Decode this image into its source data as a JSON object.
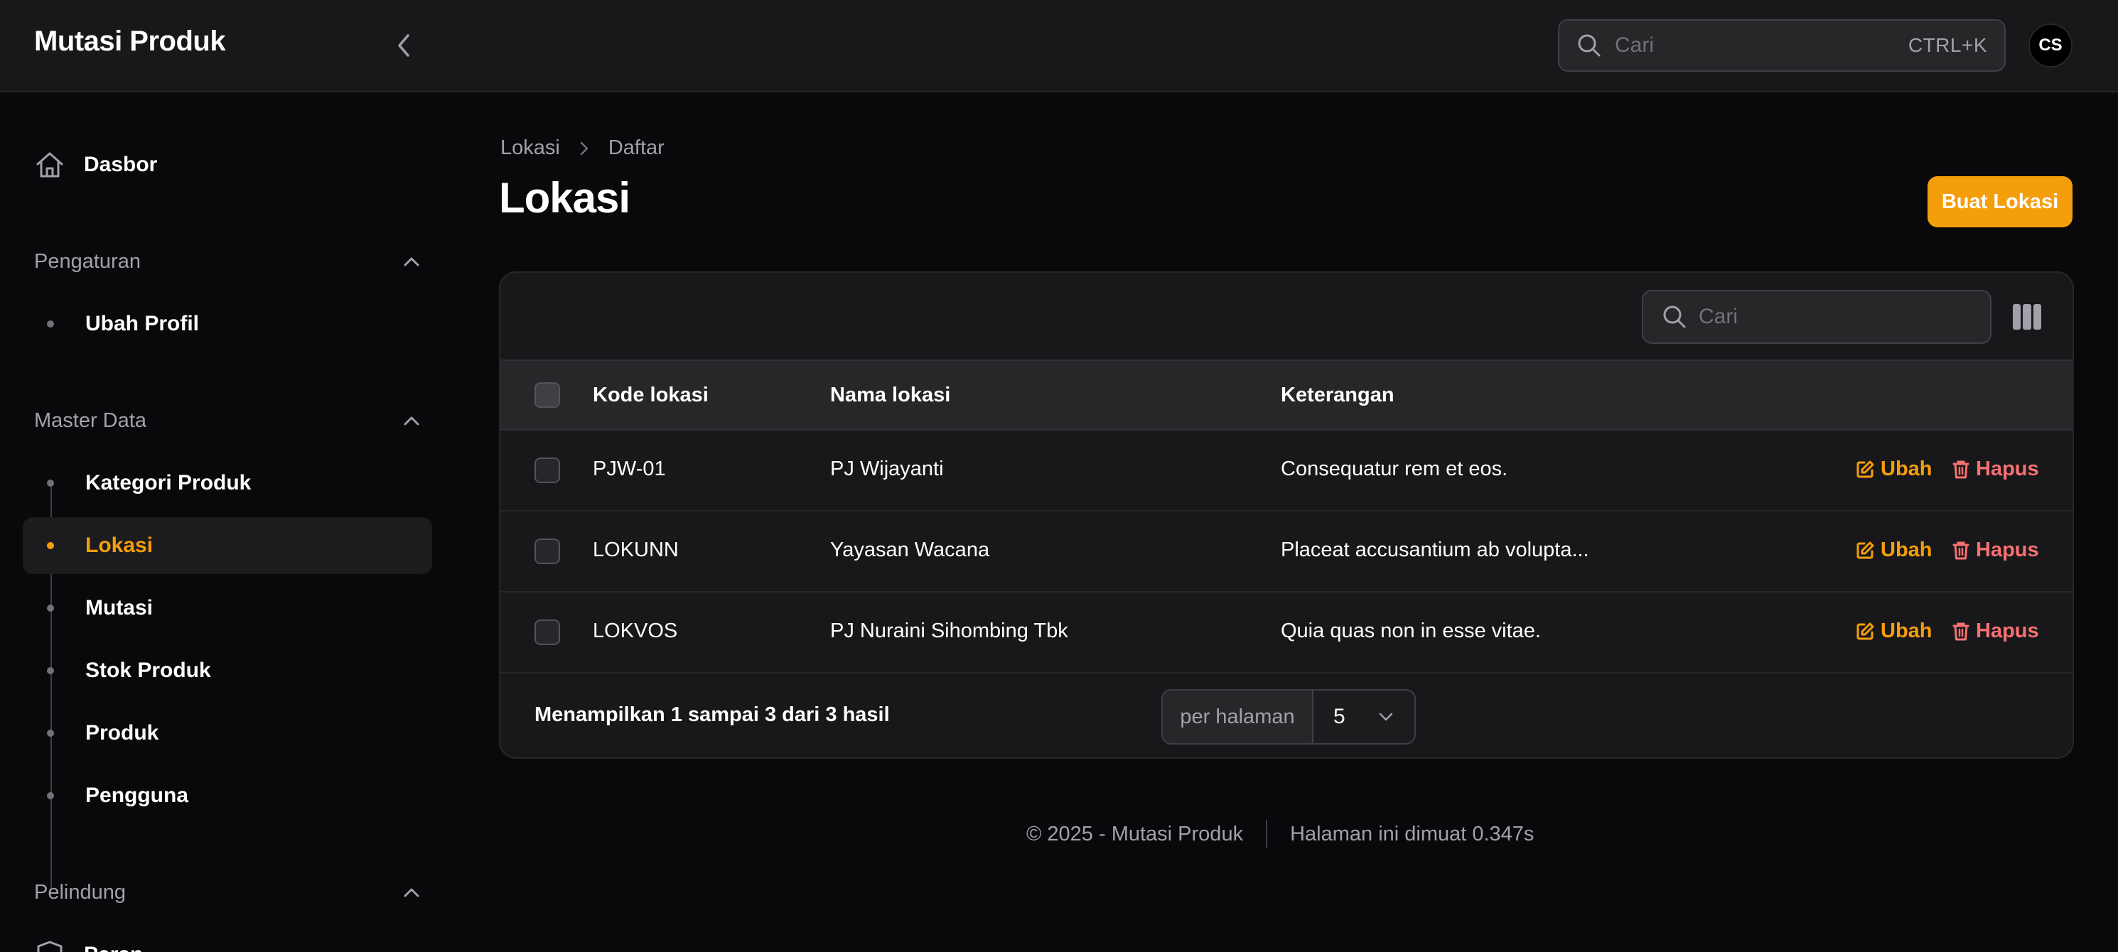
{
  "app": {
    "brand": "Mutasi Produk",
    "search_placeholder": "Cari",
    "search_shortcut": "CTRL+K",
    "avatar_initials": "CS"
  },
  "sidebar": {
    "dashboard_label": "Dasbor",
    "groups": [
      {
        "label": "Pengaturan",
        "items": [
          {
            "label": "Ubah Profil"
          }
        ]
      },
      {
        "label": "Master Data",
        "items": [
          {
            "label": "Kategori Produk"
          },
          {
            "label": "Lokasi",
            "active": true
          },
          {
            "label": "Mutasi"
          },
          {
            "label": "Stok Produk"
          },
          {
            "label": "Produk"
          },
          {
            "label": "Pengguna"
          }
        ]
      },
      {
        "label": "Pelindung",
        "items": [
          {
            "label": "Peran"
          }
        ]
      }
    ]
  },
  "page": {
    "breadcrumb": [
      "Lokasi",
      "Daftar"
    ],
    "title": "Lokasi",
    "create_button": "Buat Lokasi"
  },
  "table": {
    "search_placeholder": "Cari",
    "columns": [
      "Kode lokasi",
      "Nama lokasi",
      "Keterangan"
    ],
    "rows": [
      {
        "code": "PJW-01",
        "name": "PJ Wijayanti",
        "note": "Consequatur rem et eos."
      },
      {
        "code": "LOKUNN",
        "name": "Yayasan Wacana",
        "note": "Placeat accusantium ab volupta..."
      },
      {
        "code": "LOKVOS",
        "name": "PJ Nuraini Sihombing Tbk",
        "note": "Quia quas non in esse vitae."
      }
    ],
    "edit_label": "Ubah",
    "delete_label": "Hapus",
    "summary": "Menampilkan 1 sampai 3 dari 3 hasil",
    "per_page_label": "per halaman",
    "per_page_value": "5"
  },
  "footer": {
    "copyright": "© 2025 - Mutasi Produk",
    "load_time": "Halaman ini dimuat 0.347s"
  },
  "colors": {
    "accent": "#f59e0b",
    "danger": "#f87171",
    "background": "#09090b",
    "surface": "#18181b"
  }
}
